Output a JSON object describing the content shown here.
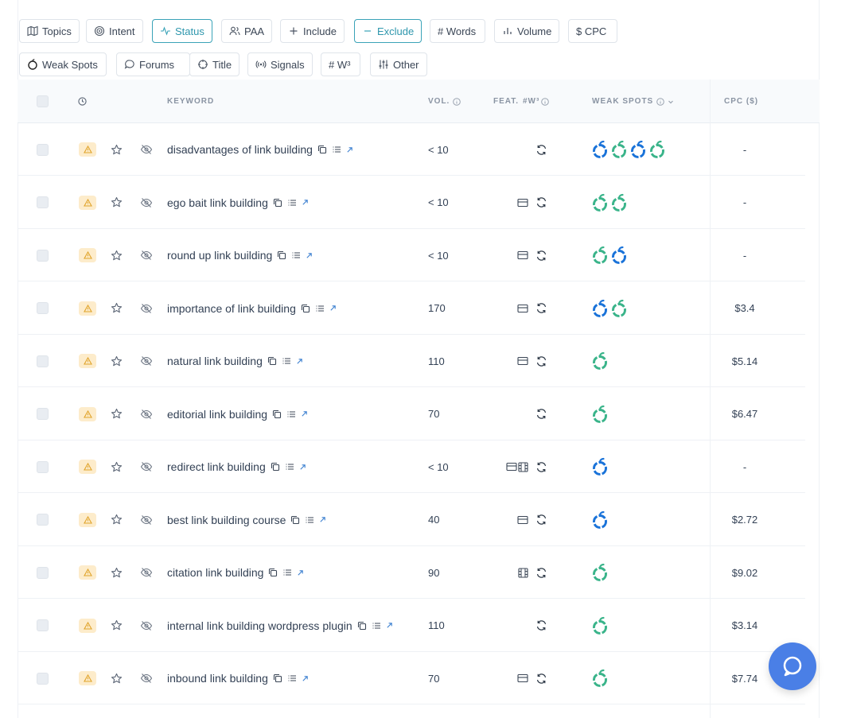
{
  "filters_row1": [
    {
      "label": "Topics",
      "icon": "map-icon",
      "active": false
    },
    {
      "label": "Intent",
      "icon": "target-icon",
      "active": false
    },
    {
      "label": "Status",
      "icon": "pulse-icon",
      "active": true
    },
    {
      "label": "PAA",
      "icon": "users-icon",
      "active": false
    },
    {
      "label": "Include",
      "icon": "plus-icon",
      "active": false
    },
    {
      "label": "Exclude",
      "icon": "minus-icon",
      "active": true
    },
    {
      "label": "# Words",
      "icon": "",
      "active": false
    },
    {
      "label": "Volume",
      "icon": "bar-chart-icon",
      "active": false
    },
    {
      "label": "$ CPC",
      "icon": "",
      "active": false
    }
  ],
  "filters_row2": [
    {
      "label": "Weak Spots",
      "icon": "apple-icon"
    },
    {
      "label": "Forums",
      "icon": "chat-icon"
    },
    {
      "label": "Title",
      "icon": "crosshair-icon"
    },
    {
      "label": "Signals",
      "icon": "broadcast-icon"
    },
    {
      "label": "# W³",
      "icon": ""
    },
    {
      "label": "Other",
      "icon": "sliders-icon"
    }
  ],
  "table": {
    "headers": {
      "keyword": "KEYWORD",
      "volume": "VOL.",
      "features": "FEAT.",
      "w3": "#W³",
      "weak_spots": "WEAK SPOTS",
      "cpc": "CPC ($)"
    },
    "rows": [
      {
        "keyword": "disadvantages of link building",
        "volume": "< 10",
        "feat": [],
        "weak": [
          "blue",
          "green",
          "blue",
          "green"
        ],
        "cpc": "-"
      },
      {
        "keyword": "ego bait link building",
        "volume": "< 10",
        "feat": [
          "card"
        ],
        "weak": [
          "green",
          "green"
        ],
        "cpc": "-"
      },
      {
        "keyword": "round up link building",
        "volume": "< 10",
        "feat": [
          "card"
        ],
        "weak": [
          "green",
          "blue"
        ],
        "cpc": "-"
      },
      {
        "keyword": "importance of link building",
        "volume": "170",
        "feat": [
          "card"
        ],
        "weak": [
          "blue",
          "green"
        ],
        "cpc": "$3.4"
      },
      {
        "keyword": "natural link building",
        "volume": "110",
        "feat": [
          "card"
        ],
        "weak": [
          "green"
        ],
        "cpc": "$5.14"
      },
      {
        "keyword": "editorial link building",
        "volume": "70",
        "feat": [],
        "weak": [
          "green"
        ],
        "cpc": "$6.47"
      },
      {
        "keyword": "redirect link building",
        "volume": "< 10",
        "feat": [
          "card",
          "film"
        ],
        "weak": [
          "blue"
        ],
        "cpc": "-"
      },
      {
        "keyword": "best link building course",
        "volume": "40",
        "feat": [
          "card"
        ],
        "weak": [
          "blue"
        ],
        "cpc": "$2.72"
      },
      {
        "keyword": "citation link building",
        "volume": "90",
        "feat": [
          "film"
        ],
        "weak": [
          "green"
        ],
        "cpc": "$9.02"
      },
      {
        "keyword": "internal link building wordpress plugin",
        "volume": "110",
        "feat": [],
        "weak": [
          "green"
        ],
        "cpc": "$3.14"
      },
      {
        "keyword": "inbound link building",
        "volume": "70",
        "feat": [
          "card"
        ],
        "weak": [
          "green"
        ],
        "cpc": "$7.74"
      }
    ]
  },
  "colors": {
    "accent": "#3aa3b8",
    "apple_blue": "#1a73d9",
    "apple_green": "#3ab48a",
    "warn_bg": "#fdeccb",
    "warn_fg": "#e0a32a",
    "help_button": "#4a7fe6"
  }
}
